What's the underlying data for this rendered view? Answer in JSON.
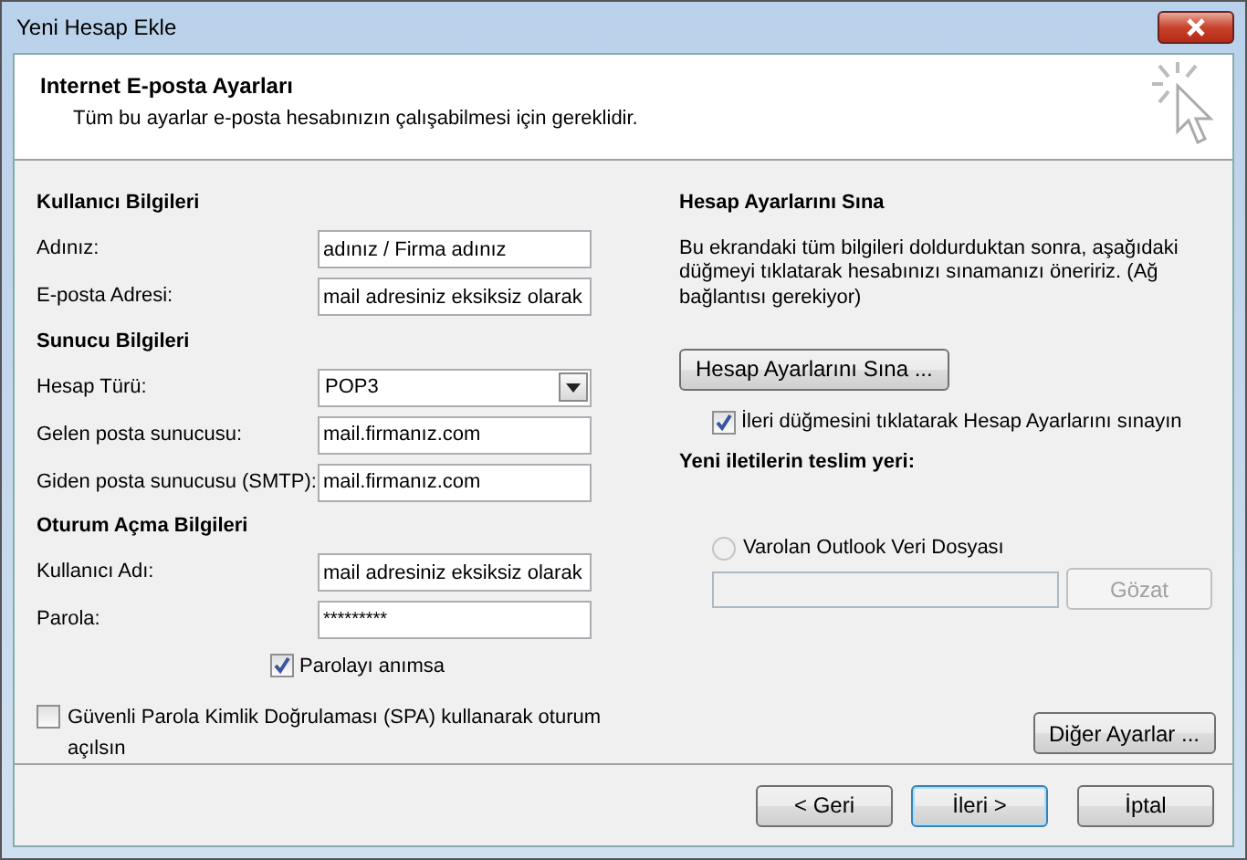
{
  "window": {
    "title": "Yeni Hesap Ekle"
  },
  "header": {
    "title": "Internet E-posta Ayarları",
    "subtitle": "Tüm bu ayarlar e-posta hesabınızın çalışabilmesi için gereklidir."
  },
  "left_sections": [
    {
      "heading": "Kullanıcı Bilgileri",
      "fields": [
        {
          "kind": "text",
          "label": "Adınız:",
          "value": "adınız / Firma adınız"
        },
        {
          "kind": "text",
          "label": "E-posta Adresi:",
          "value": "mail adresiniz eksiksiz olarak"
        }
      ]
    },
    {
      "heading": "Sunucu Bilgileri",
      "fields": [
        {
          "kind": "select",
          "label": "Hesap Türü:",
          "value": "POP3"
        },
        {
          "kind": "text",
          "label": "Gelen posta sunucusu:",
          "value": "mail.firmanız.com"
        },
        {
          "kind": "text",
          "label": "Giden posta sunucusu (SMTP):",
          "value": "mail.firmanız.com"
        }
      ]
    },
    {
      "heading": "Oturum Açma Bilgileri",
      "fields": [
        {
          "kind": "text",
          "label": "Kullanıcı Adı:",
          "value": "mail adresiniz eksiksiz olarak"
        },
        {
          "kind": "password",
          "label": "Parola:",
          "value": "*********"
        }
      ]
    }
  ],
  "remember_password": {
    "label": "Parolayı anımsa",
    "checked": true
  },
  "spa": {
    "label": "Güvenli Parola Kimlik Doğrulaması (SPA) kullanarak oturum açılsın",
    "checked": false
  },
  "test": {
    "heading": "Hesap Ayarlarını Sına",
    "description": "Bu ekrandaki tüm bilgileri doldurduktan sonra, aşağıdaki düğmeyi tıklatarak hesabınızı sınamanızı öneririz. (Ağ bağlantısı gerekiyor)",
    "button": "Hesap Ayarlarını Sına ...",
    "auto_test": {
      "label": "İleri düğmesini tıklatarak Hesap Ayarlarını sınayın",
      "checked": true
    }
  },
  "delivery": {
    "heading": "Yeni iletilerin teslim yeri:",
    "existing_file": {
      "label": "Varolan Outlook Veri Dosyası",
      "selected": false,
      "disabled": true
    },
    "path_field": {
      "disabled": true
    },
    "browse_button": {
      "label": "Gözat",
      "disabled": true
    }
  },
  "more_settings_button": "Diğer Ayarlar ...",
  "footer_buttons": [
    {
      "label": "< Geri",
      "default": false
    },
    {
      "label": "İleri >",
      "default": true
    },
    {
      "label": "İptal",
      "default": false
    }
  ]
}
